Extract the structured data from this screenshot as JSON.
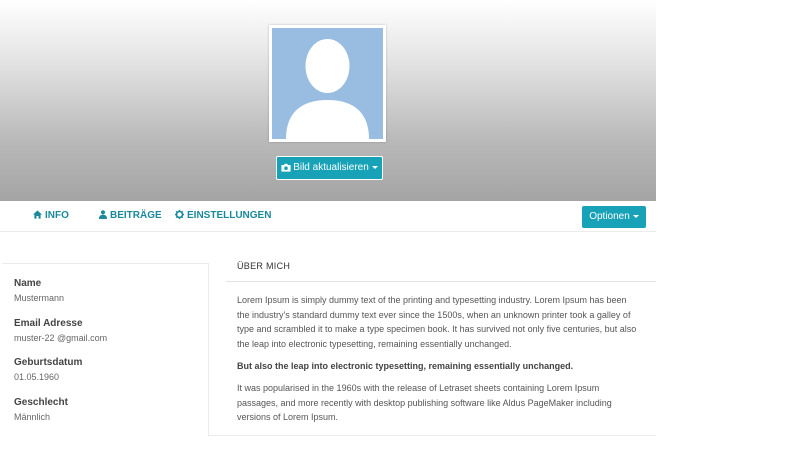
{
  "header": {
    "avatar_icon": "default-user-avatar",
    "update_button_icon": "camera-icon",
    "update_button_label": "Bild aktualisieren"
  },
  "nav": {
    "items": [
      {
        "icon": "home-icon",
        "label": "INFO"
      },
      {
        "icon": "user-icon",
        "label": "BEITRÄGE"
      },
      {
        "icon": "gear-icon",
        "label": "EINSTELLUNGEN"
      }
    ],
    "options_label": "Optionen"
  },
  "profile": {
    "fields": [
      {
        "label": "Name",
        "value": "Mustermann"
      },
      {
        "label": "Email Adresse",
        "value": "muster-22 @gmail.com"
      },
      {
        "label": "Geburtsdatum",
        "value": "01.05.1960"
      },
      {
        "label": "Geschlecht",
        "value": "Männlich"
      }
    ]
  },
  "about": {
    "title": "ÜBER MICH",
    "paragraphs": [
      "Lorem Ipsum is simply dummy text of the printing and typesetting industry. Lorem Ipsum has been the industry's standard dummy text ever since the 1500s, when an unknown printer took a galley of type and scrambled it to make a type specimen book. It has survived not only five centuries, but also the leap into electronic typesetting, remaining essentially unchanged.",
      "But also the leap into electronic typesetting, remaining essentially unchanged.",
      "It was popularised in the 1960s with the release of Letraset sheets containing Lorem Ipsum passages, and more recently with desktop publishing software like Aldus PageMaker including versions of Lorem Ipsum."
    ]
  },
  "colors": {
    "accent": "#17a2b8",
    "nav_text": "#1a8a9b",
    "avatar_bg": "#98bde1"
  }
}
